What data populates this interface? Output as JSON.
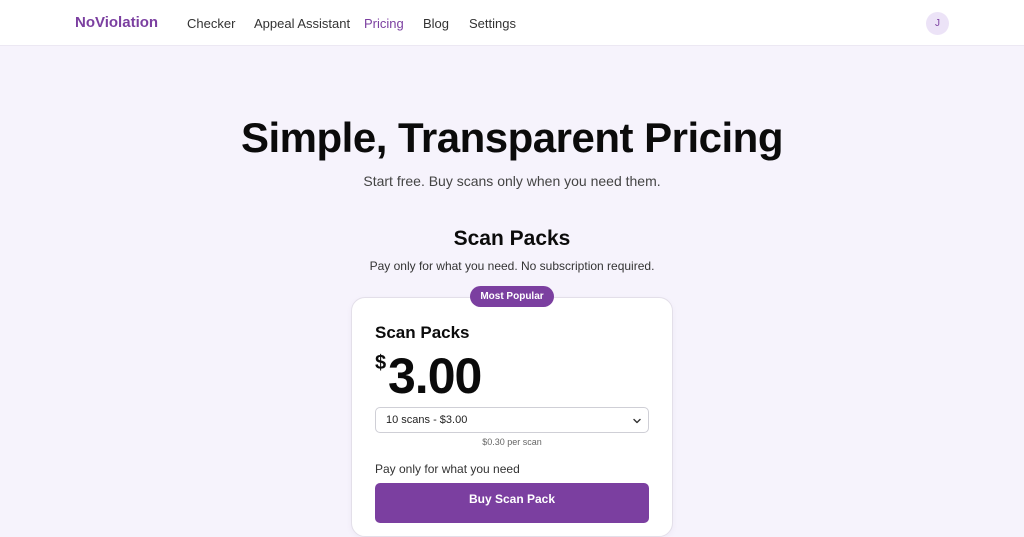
{
  "nav": {
    "brand": "NoViolation",
    "links": [
      {
        "label": "Checker",
        "active": false
      },
      {
        "label": "Appeal Assistant",
        "active": false
      },
      {
        "label": "Pricing",
        "active": true
      },
      {
        "label": "Blog",
        "active": false
      },
      {
        "label": "Settings",
        "active": false
      }
    ],
    "avatar_initial": "J"
  },
  "hero": {
    "title": "Simple, Transparent Pricing",
    "subtitle": "Start free. Buy scans only when you need them."
  },
  "section": {
    "title": "Scan Packs",
    "subtitle": "Pay only for what you need. No subscription required."
  },
  "card": {
    "badge": "Most Popular",
    "title": "Scan Packs",
    "currency": "$",
    "price": "3.00",
    "select_value": "10 scans - $3.00",
    "per_scan": "$0.30 per scan",
    "feature": "Pay only for what you need",
    "button_label": "Buy Scan Pack"
  },
  "colors": {
    "accent": "#7b3fa0",
    "background": "#f6f3fc",
    "avatar_bg": "#ece3f7"
  },
  "icons": {
    "select_arrow": "chevron-down-icon"
  }
}
